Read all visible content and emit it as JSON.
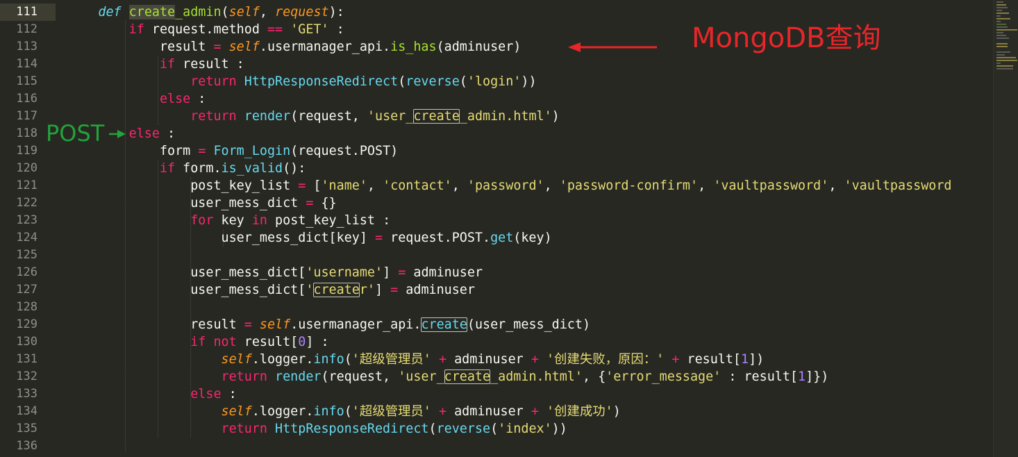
{
  "editor": {
    "lines": [
      {
        "n": "111"
      },
      {
        "n": "112"
      },
      {
        "n": "113"
      },
      {
        "n": "114"
      },
      {
        "n": "115"
      },
      {
        "n": "116"
      },
      {
        "n": "117"
      },
      {
        "n": "118"
      },
      {
        "n": "119"
      },
      {
        "n": "120"
      },
      {
        "n": "121"
      },
      {
        "n": "122"
      },
      {
        "n": "123"
      },
      {
        "n": "124"
      },
      {
        "n": "125"
      },
      {
        "n": "126"
      },
      {
        "n": "127"
      },
      {
        "n": "128"
      },
      {
        "n": "129"
      },
      {
        "n": "130"
      },
      {
        "n": "131"
      },
      {
        "n": "132"
      },
      {
        "n": "133"
      },
      {
        "n": "134"
      },
      {
        "n": "135"
      },
      {
        "n": "136"
      }
    ],
    "code": {
      "l111": {
        "def": "def",
        "fn_a": "create",
        "fn_b": "_admin",
        "p1": "(",
        "self": "self",
        "comma": ", ",
        "req": "request",
        "p2": "):"
      },
      "l112": {
        "kw": "if",
        "a": " request.method ",
        "op": "==",
        "b": " ",
        "s": "'GET'",
        "c": " :"
      },
      "l113": {
        "a": "result ",
        "op": "=",
        "b": " ",
        "self": "self",
        "c": ".usermanager_api.",
        "call": "is_has",
        "d": "(adminuser)"
      },
      "l114": {
        "kw": "if",
        "a": " result :"
      },
      "l115": {
        "kw": "return",
        "a": " ",
        "call": "HttpResponseRedirect",
        "b": "(",
        "call2": "reverse",
        "c": "(",
        "s": "'login'",
        "d": "))"
      },
      "l116": {
        "kw": "else",
        "a": " :"
      },
      "l117": {
        "kw": "return",
        "a": " ",
        "call": "render",
        "b": "(request, ",
        "s1": "'user_",
        "s2": "create",
        "s3": "_admin.html'",
        "c": ")"
      },
      "l118": {
        "kw": "else",
        "a": " :"
      },
      "l119": {
        "a": "form ",
        "op": "=",
        "b": " ",
        "call": "Form_Login",
        "c": "(request.POST)"
      },
      "l120": {
        "kw": "if",
        "a": " form.",
        "call": "is_valid",
        "b": "():"
      },
      "l121": {
        "a": "post_key_list ",
        "op": "=",
        "b": " [",
        "s1": "'name'",
        "c1": ", ",
        "s2": "'contact'",
        "c2": ", ",
        "s3": "'password'",
        "c3": ", ",
        "s4": "'password-confirm'",
        "c4": ", ",
        "s5": "'vaultpassword'",
        "c5": ", ",
        "s6": "'vaultpassword"
      },
      "l122": {
        "a": "user_mess_dict ",
        "op": "=",
        "b": " {}"
      },
      "l123": {
        "kw": "for",
        "a": " key ",
        "kw2": "in",
        "b": " post_key_list :"
      },
      "l124": {
        "a": "user_mess_dict[key] ",
        "op": "=",
        "b": " request.POST.",
        "call": "get",
        "c": "(key)"
      },
      "l126": {
        "a": "user_mess_dict[",
        "s": "'username'",
        "b": "] ",
        "op": "=",
        "c": " adminuser"
      },
      "l127": {
        "a": "user_mess_dict[",
        "s1": "'",
        "s2": "create",
        "s3": "r'",
        "b": "] ",
        "op": "=",
        "c": " adminuser"
      },
      "l129": {
        "a": "result ",
        "op": "=",
        "b": " ",
        "self": "self",
        "c": ".usermanager_api.",
        "call": "create",
        "d": "(user_mess_dict)"
      },
      "l130": {
        "kw": "if",
        "a": " ",
        "kw2": "not",
        "b": " result[",
        "num": "0",
        "c": "] :"
      },
      "l131": {
        "self": "self",
        "a": ".logger.",
        "call": "info",
        "b": "(",
        "s1": "'超级管理员'",
        "c": " ",
        "op1": "+",
        "d": " adminuser ",
        "op2": "+",
        "e": " ",
        "s2": "'创建失败，原因：'",
        "f": " ",
        "op3": "+",
        "g": " result[",
        "num": "1",
        "h": "])"
      },
      "l132": {
        "kw": "return",
        "a": " ",
        "call": "render",
        "b": "(request, ",
        "s1": "'user_",
        "s2": "create",
        "s3": "_admin.html'",
        "c": ", {",
        "s4": "'error_message'",
        "d": " : result[",
        "num": "1",
        "e": "]})"
      },
      "l133": {
        "kw": "else",
        "a": " :"
      },
      "l134": {
        "self": "self",
        "a": ".logger.",
        "call": "info",
        "b": "(",
        "s1": "'超级管理员'",
        "c": " ",
        "op1": "+",
        "d": " adminuser ",
        "op2": "+",
        "e": " ",
        "s2": "'创建成功'",
        "f": ")"
      },
      "l135": {
        "kw": "return",
        "a": " ",
        "call": "HttpResponseRedirect",
        "b": "(",
        "call2": "reverse",
        "c": "(",
        "s": "'index'",
        "d": "))"
      }
    }
  },
  "annotations": {
    "mongo_label": "MongoDB查询",
    "post_label": "POST"
  },
  "colors": {
    "background": "#272822",
    "keyword": "#f92672",
    "function": "#a6e22e",
    "string": "#e6db74",
    "self": "#fd971f",
    "builtin_call": "#66d9ef",
    "number": "#ae81ff",
    "annotation_red": "#e8262a",
    "annotation_green": "#22a33c"
  }
}
